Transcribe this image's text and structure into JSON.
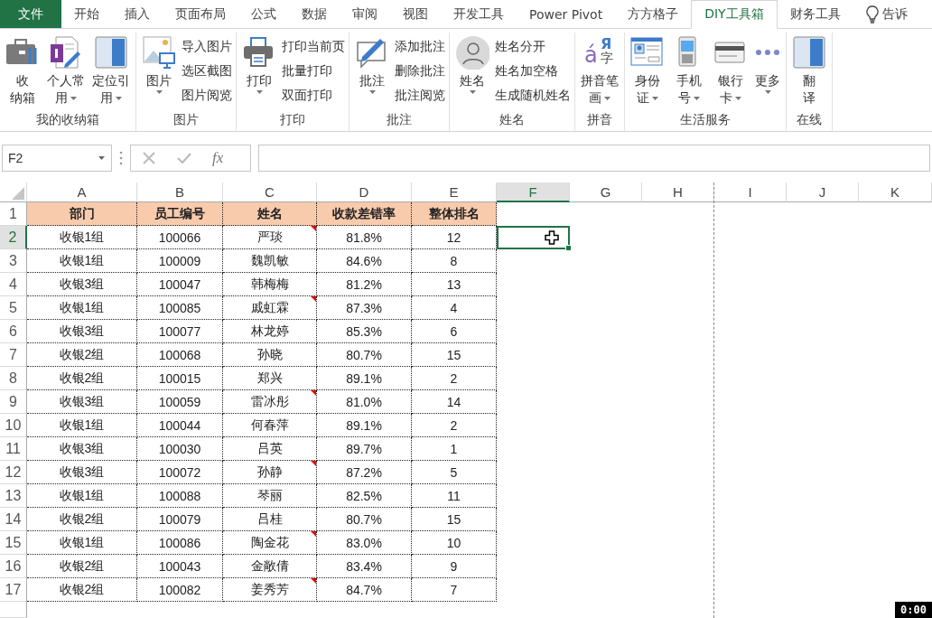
{
  "tabs": [
    {
      "label": "文件",
      "kind": "file",
      "selected": false
    },
    {
      "label": "开始",
      "kind": "tab",
      "selected": false
    },
    {
      "label": "插入",
      "kind": "tab",
      "selected": false
    },
    {
      "label": "页面布局",
      "kind": "tab",
      "selected": false
    },
    {
      "label": "公式",
      "kind": "tab",
      "selected": false
    },
    {
      "label": "数据",
      "kind": "tab",
      "selected": false
    },
    {
      "label": "审阅",
      "kind": "tab",
      "selected": false
    },
    {
      "label": "视图",
      "kind": "tab",
      "selected": false
    },
    {
      "label": "开发工具",
      "kind": "tab",
      "selected": false
    },
    {
      "label": "Power Pivot",
      "kind": "tab",
      "selected": false
    },
    {
      "label": "方方格子",
      "kind": "tab",
      "selected": false
    },
    {
      "label": "DIY工具箱",
      "kind": "tab",
      "selected": true
    },
    {
      "label": "财务工具",
      "kind": "tab",
      "selected": false
    },
    {
      "label": "告诉",
      "kind": "tell",
      "selected": false
    }
  ],
  "ribbon_groups": [
    {
      "label": "我的收纳箱",
      "items": [
        {
          "kind": "large",
          "lines": [
            "收",
            "纳箱"
          ],
          "dropdown": false
        },
        {
          "kind": "large",
          "lines": [
            "个人常",
            "用"
          ],
          "dropdown": true
        },
        {
          "kind": "large",
          "lines": [
            "定位引",
            "用"
          ],
          "dropdown": true
        }
      ]
    },
    {
      "label": "图片",
      "items": [
        {
          "kind": "large",
          "lines": [
            "图片"
          ],
          "dropdown": true
        },
        {
          "kind": "stack",
          "entries": [
            "导入图片",
            "选区截图",
            "图片阅览"
          ]
        }
      ]
    },
    {
      "label": "打印",
      "items": [
        {
          "kind": "large",
          "lines": [
            "打印"
          ],
          "dropdown": true
        },
        {
          "kind": "stack",
          "entries": [
            "打印当前页",
            "批量打印",
            "双面打印"
          ]
        }
      ]
    },
    {
      "label": "批注",
      "items": [
        {
          "kind": "large",
          "lines": [
            "批注"
          ],
          "dropdown": true
        },
        {
          "kind": "stack",
          "entries": [
            "添加批注",
            "删除批注",
            "批注阅览"
          ]
        }
      ]
    },
    {
      "label": "姓名",
      "items": [
        {
          "kind": "large",
          "lines": [
            "姓名"
          ],
          "dropdown": true
        },
        {
          "kind": "stack",
          "entries": [
            "姓名分开",
            "姓名加空格",
            "生成随机姓名"
          ]
        }
      ]
    },
    {
      "label": "拼音",
      "items": [
        {
          "kind": "large",
          "lines": [
            "拼音笔",
            "画"
          ],
          "dropdown": true,
          "glyphs": [
            "á",
            "Я",
            "字"
          ]
        }
      ]
    },
    {
      "label": "生活服务",
      "items": [
        {
          "kind": "large",
          "lines": [
            "身份",
            "证"
          ],
          "dropdown": true
        },
        {
          "kind": "large",
          "lines": [
            "手机",
            "号"
          ],
          "dropdown": true
        },
        {
          "kind": "large",
          "lines": [
            "银行",
            "卡"
          ],
          "dropdown": true
        },
        {
          "kind": "large",
          "lines": [
            "更多"
          ],
          "dropdown": true
        }
      ]
    },
    {
      "label": "在线",
      "items": [
        {
          "kind": "large",
          "lines": [
            "翻",
            "译"
          ],
          "dropdown": false
        }
      ]
    }
  ],
  "formula_bar": {
    "name_box": "F2",
    "fx": "fx"
  },
  "columns": [
    {
      "label": "A",
      "selected": false
    },
    {
      "label": "B",
      "selected": false
    },
    {
      "label": "C",
      "selected": false
    },
    {
      "label": "D",
      "selected": false
    },
    {
      "label": "E",
      "selected": false
    },
    {
      "label": "F",
      "selected": true
    },
    {
      "label": "G",
      "selected": false
    },
    {
      "label": "H",
      "selected": false
    },
    {
      "label": "I",
      "selected": false
    },
    {
      "label": "J",
      "selected": false
    },
    {
      "label": "K",
      "selected": false
    }
  ],
  "header_row": {
    "number": "1",
    "selected": false,
    "cells": [
      "部门",
      "员工编号",
      "姓名",
      "收款差错率",
      "整体排名"
    ]
  },
  "rows": [
    {
      "number": "2",
      "selected": true,
      "cells": [
        "收银1组",
        "100066",
        "严琰",
        "81.8%",
        "12"
      ],
      "comment": true
    },
    {
      "number": "3",
      "selected": false,
      "cells": [
        "收银1组",
        "100009",
        "魏凯敏",
        "84.6%",
        "8"
      ],
      "comment": false
    },
    {
      "number": "4",
      "selected": false,
      "cells": [
        "收银3组",
        "100047",
        "韩梅梅",
        "81.2%",
        "13"
      ],
      "comment": false
    },
    {
      "number": "5",
      "selected": false,
      "cells": [
        "收银1组",
        "100085",
        "戚虹霖",
        "87.3%",
        "4"
      ],
      "comment": true
    },
    {
      "number": "6",
      "selected": false,
      "cells": [
        "收银3组",
        "100077",
        "林龙婷",
        "85.3%",
        "6"
      ],
      "comment": false
    },
    {
      "number": "7",
      "selected": false,
      "cells": [
        "收银2组",
        "100068",
        "孙晓",
        "80.7%",
        "15"
      ],
      "comment": false
    },
    {
      "number": "8",
      "selected": false,
      "cells": [
        "收银2组",
        "100015",
        "郑兴",
        "89.1%",
        "2"
      ],
      "comment": false
    },
    {
      "number": "9",
      "selected": false,
      "cells": [
        "收银3组",
        "100059",
        "雷冰彤",
        "81.0%",
        "14"
      ],
      "comment": true
    },
    {
      "number": "10",
      "selected": false,
      "cells": [
        "收银1组",
        "100044",
        "何春萍",
        "89.1%",
        "2"
      ],
      "comment": false
    },
    {
      "number": "11",
      "selected": false,
      "cells": [
        "收银3组",
        "100030",
        "吕英",
        "89.7%",
        "1"
      ],
      "comment": false
    },
    {
      "number": "12",
      "selected": false,
      "cells": [
        "收银3组",
        "100072",
        "孙静",
        "87.2%",
        "5"
      ],
      "comment": true
    },
    {
      "number": "13",
      "selected": false,
      "cells": [
        "收银1组",
        "100088",
        "琴丽",
        "82.5%",
        "11"
      ],
      "comment": false
    },
    {
      "number": "14",
      "selected": false,
      "cells": [
        "收银2组",
        "100079",
        "吕桂",
        "80.7%",
        "15"
      ],
      "comment": false
    },
    {
      "number": "15",
      "selected": false,
      "cells": [
        "收银1组",
        "100086",
        "陶金花",
        "83.0%",
        "10"
      ],
      "comment": true
    },
    {
      "number": "16",
      "selected": false,
      "cells": [
        "收银2组",
        "100043",
        "金敞倩",
        "83.4%",
        "9"
      ],
      "comment": false
    },
    {
      "number": "17",
      "selected": false,
      "cells": [
        "收银2组",
        "100082",
        "姜秀芳",
        "84.7%",
        "7"
      ],
      "comment": true
    }
  ],
  "timer": "0:00"
}
